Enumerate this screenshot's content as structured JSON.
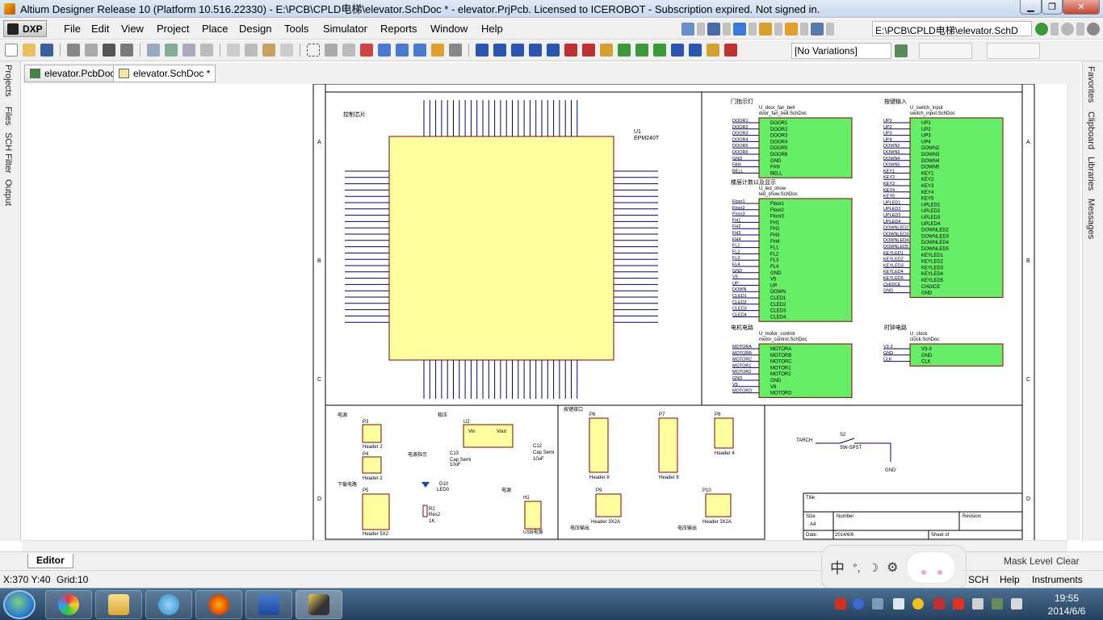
{
  "window": {
    "title": "Altium Designer Release 10 (Platform 10.516.22330) - E:\\PCB\\CPLD电梯\\elevator.SchDoc * - elevator.PrjPcb. Licensed to ICEROBOT - Subscription expired. Not signed in.",
    "min": "▁",
    "max": "❐",
    "close": "✕"
  },
  "menu": {
    "dxp": "DXP",
    "items": [
      "File",
      "Edit",
      "View",
      "Project",
      "Place",
      "Design",
      "Tools",
      "Simulator",
      "Reports",
      "Window",
      "Help"
    ],
    "path": "E:\\PCB\\CPLD电梯\\elevator.SchD"
  },
  "toolbar": {
    "variations": "[No Variations]"
  },
  "doctabs": [
    "elevator.PcbDoc",
    "elevator.SchDoc *"
  ],
  "left_panels": [
    "Projects",
    "Files",
    "SCH Filter",
    "Output"
  ],
  "right_panels": [
    "Favorites",
    "Clipboard",
    "Libraries",
    "Messages"
  ],
  "schematic": {
    "left_box_title": "控制芯片",
    "u1_ref": "U1",
    "u1_part": "EPM240T",
    "sheets": {
      "door": {
        "heading": "门指示灯",
        "name": "U_door_fan_bell",
        "file": "door_fan_bell.SchDoc",
        "ports": [
          "DOOR1",
          "DOOR2",
          "DOOR3",
          "DOOR4",
          "DOOR5",
          "DOOR6",
          "GND",
          "FAN",
          "BELL"
        ]
      },
      "switch": {
        "heading": "按键输入",
        "name": "U_switch_input",
        "file": "switch_input.SchDoc",
        "ports": [
          "UP1",
          "UP2",
          "UP3",
          "UP4",
          "DOWN2",
          "DOWN3",
          "DOWN4",
          "DOWN5",
          "KEY1",
          "KEY2",
          "KEY3",
          "KEY4",
          "KEY5",
          "UPLED1",
          "UPLED2",
          "UPLED3",
          "UPLED4",
          "DOWNLED2",
          "DOWNLED3",
          "DOWNLED4",
          "DOWNLED5",
          "KEYLED1",
          "KEYLED2",
          "KEYLED3",
          "KEYLED4",
          "KEYLED5",
          "CHOICE",
          "GND"
        ]
      },
      "led": {
        "heading": "楼层计数以及显示",
        "name": "U_led_show",
        "file": "led_show.SchDoc",
        "ports": [
          "Floor1",
          "Floor2",
          "Floor3",
          "FH1",
          "FH2",
          "FH3",
          "FH4",
          "FL1",
          "FL2",
          "FL3",
          "FL4",
          "GND",
          "V5",
          "UP",
          "DOWN",
          "CLED1",
          "CLED2",
          "CLED3",
          "CLED4"
        ]
      },
      "motor": {
        "heading": "电机电路",
        "name": "U_motor_control",
        "file": "motor_control.SchDoc",
        "ports": [
          "MOTORA",
          "MOTORB",
          "MOTORC",
          "MOTOR1",
          "MOTOR2",
          "GND",
          "V9",
          "MOTORD"
        ]
      },
      "clock": {
        "heading": "时钟电路",
        "name": "U_clock",
        "file": "clock.SchDoc",
        "ports": [
          "V3-3",
          "GND",
          "CLK"
        ]
      }
    },
    "bottom": {
      "power": "电源",
      "regulator": "稳压",
      "led_label": "电源指示",
      "download": "下载电路",
      "keyport": "按键接口",
      "voltage_out": "电压输出",
      "usb": "USB电源",
      "tarch": "TARCH",
      "switch_ref": "S2",
      "switch_part": "SW-SPST",
      "gnd": "GND",
      "u2": "U2",
      "vin": "Vin",
      "vout": "Vout",
      "d10": "D10",
      "led0": "LED0",
      "r2": "R2",
      "res": "Res2",
      "r_val": "1K",
      "c13": "C13",
      "c12": "C12",
      "cap": "Cap Semi",
      "cval": "10uF",
      "h1": "H1",
      "p3": "P3",
      "p4": "P4",
      "p5": "P5",
      "p6": "P6",
      "p7": "P7",
      "p8": "P8",
      "p9": "P9",
      "p10": "P10",
      "header2": "Header 2",
      "header4": "Header 4",
      "header8": "Header 8",
      "header5x2": "Header 5X2",
      "header3x2": "Header 3X2A",
      "title_lbl": "Title",
      "size_lbl": "Size",
      "size_val": "A4",
      "number_lbl": "Number",
      "revision_lbl": "Revision",
      "date_lbl": "Date:",
      "date_val": "2014/6/6",
      "sheet_lbl": "Sheet     of"
    }
  },
  "editor_tab": "Editor",
  "status": {
    "coords": "X:370 Y:40",
    "grid": "Grid:10",
    "right_items": [
      "SCH",
      "Help",
      "Instruments"
    ],
    "mask": "Mask Level",
    "clear": "Clear"
  },
  "ime": {
    "chars": [
      "中",
      "°,",
      "☽",
      "⚙"
    ]
  },
  "clock": {
    "time": "19:55",
    "date": "2014/6/6"
  },
  "colors": {
    "sheet_fill": "#66ee66",
    "chip_fill": "#ffffa0",
    "wire": "#000080",
    "border": "#000000"
  }
}
